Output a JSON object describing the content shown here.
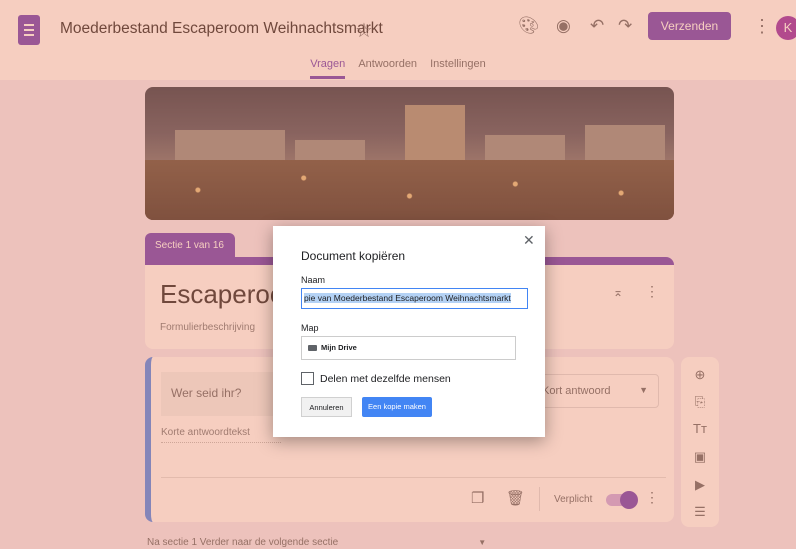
{
  "header": {
    "title": "Moederbestand Escaperoom Weihnachtsmarkt",
    "send_label": "Verzenden",
    "avatar_initial": "K"
  },
  "tabs": [
    {
      "label": "Vragen",
      "active": true
    },
    {
      "label": "Antwoorden",
      "active": false
    },
    {
      "label": "Instellingen",
      "active": false
    }
  ],
  "form": {
    "section_tab": "Sectie 1 van 16",
    "title": "Escaperoom",
    "description": "Formulierbeschrijving",
    "question": {
      "title": "Wer seid ihr?",
      "type": "Kort antwoord",
      "answer_placeholder": "Korte antwoordtekst",
      "required_label": "Verplicht",
      "required": true
    },
    "after_section": "Na sectie 1   Verder naar de volgende sectie"
  },
  "dialog": {
    "title": "Document kopiëren",
    "name_label": "Naam",
    "name_value": "pie van Moederbestand Escaperoom Weihnachtsmarkt",
    "folder_label": "Map",
    "folder_value": "Mijn Drive",
    "share_label": "Delen met dezelfde mensen",
    "share_checked": false,
    "cancel_label": "Annuleren",
    "copy_label": "Een kopie maken"
  },
  "colors": {
    "accent": "#673ab7",
    "primary_button": "#4285f4",
    "overlay": "#e88462"
  },
  "icons": {
    "header": [
      "palette-icon",
      "preview-icon",
      "undo-icon",
      "redo-icon",
      "more-icon"
    ],
    "toolbar": [
      "add-question-icon",
      "import-icon",
      "title-icon",
      "image-icon",
      "video-icon",
      "section-icon"
    ]
  }
}
